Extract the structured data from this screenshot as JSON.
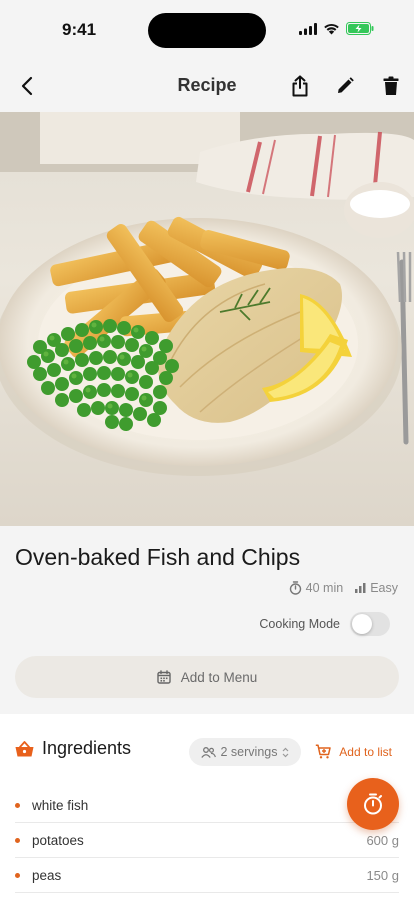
{
  "status_bar": {
    "time": "9:41"
  },
  "nav": {
    "title": "Recipe"
  },
  "recipe": {
    "title": "Oven-baked Fish and Chips",
    "time": "40 min",
    "difficulty": "Easy",
    "cooking_mode_label": "Cooking Mode",
    "cooking_mode_on": false,
    "add_to_menu_label": "Add to Menu"
  },
  "ingredients": {
    "title": "Ingredients",
    "servings": "2 servings",
    "add_to_list_label": "Add to list",
    "items": [
      {
        "name": "white fish",
        "qty": ""
      },
      {
        "name": "potatoes",
        "qty": "600 g"
      },
      {
        "name": "peas",
        "qty": "150 g"
      }
    ]
  },
  "colors": {
    "accent": "#e8611c",
    "background": "#f4f4f4"
  },
  "icons": [
    "back-icon",
    "share-icon",
    "edit-icon",
    "trash-icon",
    "timer-icon",
    "difficulty-icon",
    "calendar-icon",
    "basket-icon",
    "users-icon",
    "add-cart-icon",
    "stopwatch-icon"
  ]
}
